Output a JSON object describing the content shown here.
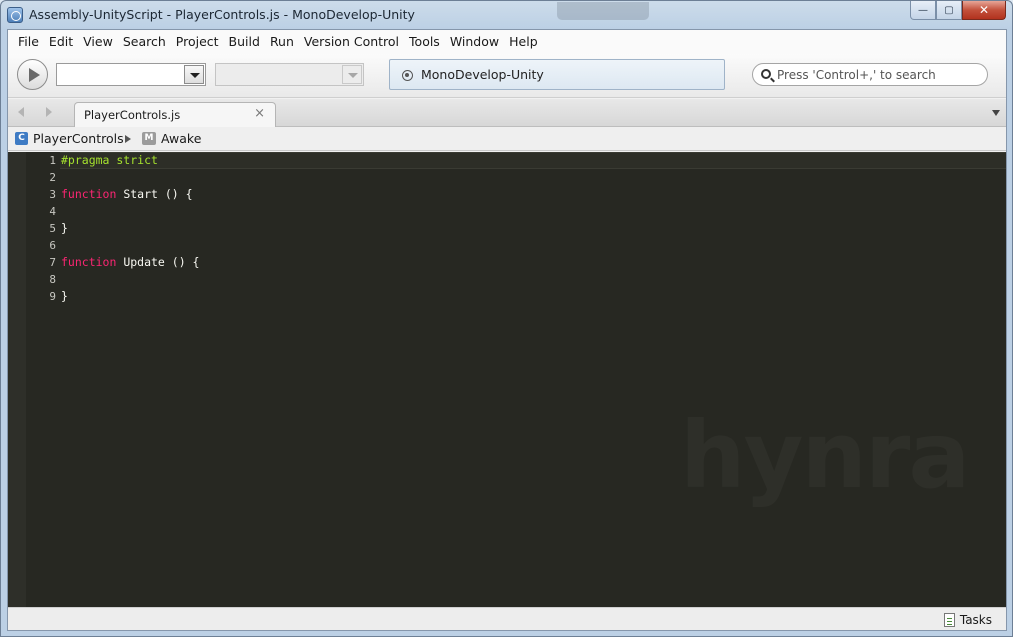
{
  "window": {
    "title": "Assembly-UnityScript - PlayerControls.js - MonoDevelop-Unity",
    "minimize_glyph": "—",
    "maximize_glyph": "▢",
    "close_glyph": "✕"
  },
  "menubar": {
    "items": [
      "File",
      "Edit",
      "View",
      "Search",
      "Project",
      "Build",
      "Run",
      "Version Control",
      "Tools",
      "Window",
      "Help"
    ]
  },
  "toolbar": {
    "run_icon": "play-icon",
    "config_value": "",
    "platform_value": "",
    "status_text": "MonoDevelop-Unity",
    "search_placeholder": "Press 'Control+,' to search"
  },
  "tabs": [
    {
      "label": "PlayerControls.js",
      "active": true,
      "close_glyph": "×"
    }
  ],
  "pathbar": {
    "class_icon_letter": "C",
    "class_name": "PlayerControls",
    "method_icon_letter": "M",
    "method_name": "Awake"
  },
  "editor": {
    "theme_colors": {
      "background": "#272822",
      "keyword": "#f92672",
      "pragma": "#a6e22e",
      "text": "#f8f8f2"
    },
    "line_numbers": [
      "1",
      "2",
      "3",
      "4",
      "5",
      "6",
      "7",
      "8",
      "9"
    ],
    "lines": [
      {
        "parts": [
          {
            "text": "#pragma strict",
            "kind": "pragma"
          }
        ]
      },
      {
        "parts": []
      },
      {
        "parts": [
          {
            "text": "function",
            "kind": "kw"
          },
          {
            "text": " Start () {",
            "kind": "ident"
          }
        ]
      },
      {
        "parts": []
      },
      {
        "parts": [
          {
            "text": "}",
            "kind": "ident"
          }
        ]
      },
      {
        "parts": []
      },
      {
        "parts": [
          {
            "text": "function",
            "kind": "kw"
          },
          {
            "text": " Update () {",
            "kind": "ident"
          }
        ]
      },
      {
        "parts": []
      },
      {
        "parts": [
          {
            "text": "}",
            "kind": "ident"
          }
        ]
      }
    ],
    "watermark": "hynra"
  },
  "statusbar": {
    "tasks_label": "Tasks"
  }
}
